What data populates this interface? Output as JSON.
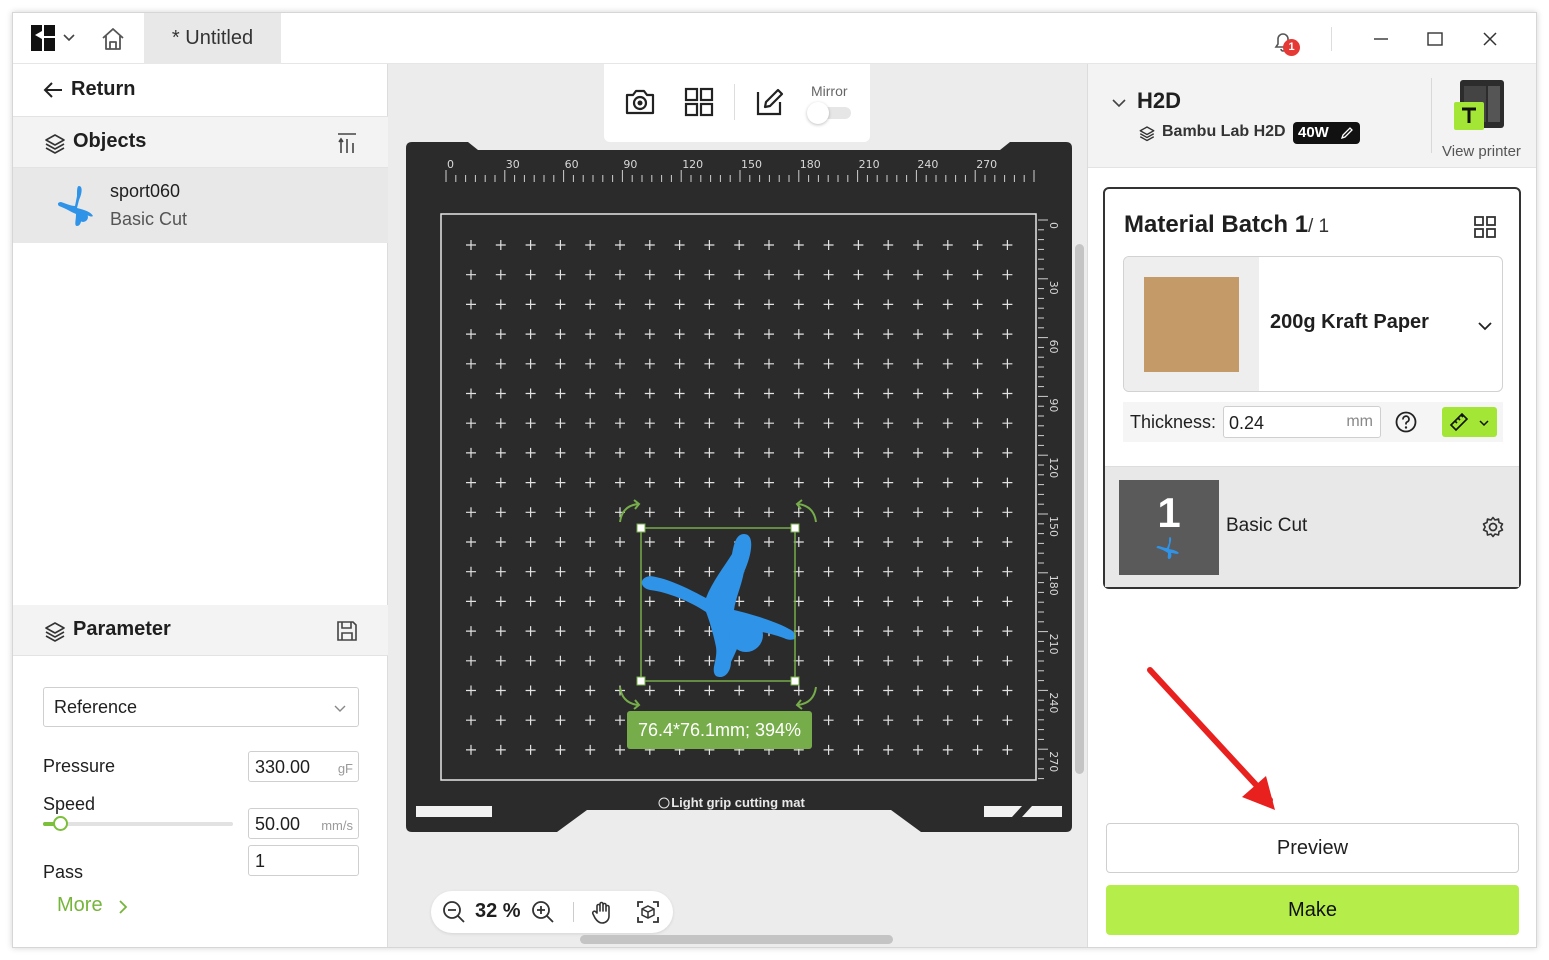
{
  "titlebar": {
    "tab_title": "* Untitled",
    "notification_count": "1"
  },
  "left_panel": {
    "return_label": "Return",
    "objects_label": "Objects",
    "object": {
      "name": "sport060",
      "subtitle": "Basic Cut"
    },
    "parameter_label": "Parameter",
    "preset": "Reference",
    "pressure": {
      "label": "Pressure",
      "value": "330.00",
      "unit": "gF"
    },
    "speed": {
      "label": "Speed",
      "value": "50.00",
      "unit": "mm/s",
      "slider_level": 0.05
    },
    "pass": {
      "label": "Pass",
      "value": "1"
    },
    "more_label": "More"
  },
  "canvas": {
    "toolbar": {
      "mirror_label": "Mirror",
      "mirror_on": false
    },
    "ruler_top": [
      "0",
      "30",
      "60",
      "90",
      "120",
      "150",
      "180",
      "210",
      "240",
      "270"
    ],
    "ruler_right": [
      "0",
      "30",
      "60",
      "90",
      "120",
      "150",
      "180",
      "210",
      "240",
      "270"
    ],
    "mat_label": "Light grip cutting mat",
    "selection_size": "76.4*76.1mm; 394%",
    "zoom_value": "32 %"
  },
  "right_panel": {
    "printer_name": "H2D",
    "printer_model": "Bambu Lab H2D",
    "laser_power": "40W",
    "view_printer_label": "View printer",
    "batch_title": "Material Batch 1",
    "batch_count": "/ 1",
    "material_name": "200g Kraft Paper",
    "thickness_label": "Thickness:",
    "thickness_value": "0.24",
    "thickness_unit": "mm",
    "layer_number": "1",
    "layer_name": "Basic Cut",
    "preview_label": "Preview",
    "make_label": "Make"
  },
  "colors": {
    "accent_green": "#b5ee4a",
    "object_blue": "#2f93e8",
    "mat_dark": "#2b2b2b",
    "kraft": "#c49a69",
    "annotation_red": "#e8201e"
  }
}
